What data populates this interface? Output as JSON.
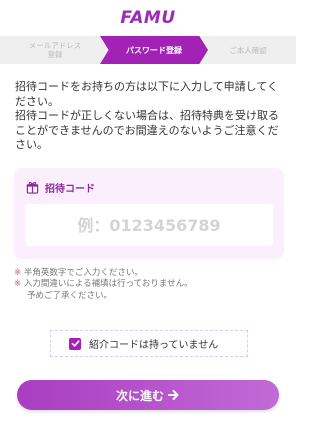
{
  "brand": {
    "logo_text": "FAMU",
    "accent": "#a222b5"
  },
  "steps": [
    {
      "label": "メールアドレス\n登録",
      "state": "done"
    },
    {
      "label": "パスワード登録",
      "state": "active"
    },
    {
      "label": "ご本人確認",
      "state": "todo"
    }
  ],
  "intro": {
    "line1": "招待コードをお持ちの方は以下に入力して申請してください。",
    "line2": "招待コードが正しくない場合は、招待特典を受け取ることができませんのでお間違えのないようご注意ください。"
  },
  "code_form": {
    "label": "招待コード",
    "placeholder": "例：0123456789",
    "icon": "gift-icon"
  },
  "notes": {
    "mark": "※",
    "note1": "半角英数字でご入力ください。",
    "note2": "入力間違いによる補填は行っておりません。",
    "note2_cont": "予めご了承ください。"
  },
  "no_code": {
    "label": "紹介コードは持っていません",
    "checked": true
  },
  "next_button": {
    "label": "次に進む",
    "icon": "arrow-right-icon"
  }
}
